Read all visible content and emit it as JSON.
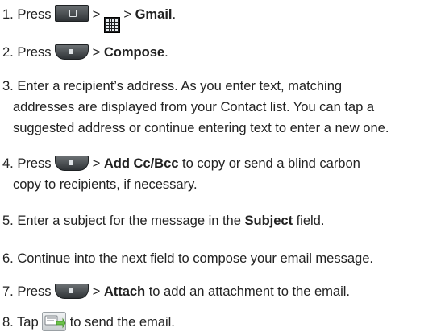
{
  "steps": [
    {
      "num": "1.",
      "t1": "Press",
      "t2": ">",
      "t3": "> ",
      "bold": "Gmail",
      "t4": "."
    },
    {
      "num": "2.",
      "t1": "Press",
      "t2": "> ",
      "bold": "Compose",
      "t3": "."
    },
    {
      "num": "3.",
      "lines": [
        "Enter a recipient’s address. As you enter text, matching",
        "addresses are displayed from your Contact list. You can tap a",
        "suggested address or continue entering text to enter a new one."
      ]
    },
    {
      "num": "4.",
      "t1": "Press",
      "t2": "> ",
      "bold": "Add Cc/Bcc",
      "t3": " to copy or send a blind carbon",
      "line2": "copy to recipients, if necessary."
    },
    {
      "num": "5.",
      "t1": "Enter a subject for the message in the ",
      "bold": "Subject",
      "t2": " field."
    },
    {
      "num": "6.",
      "t1": "Continue into the next field to compose your email message."
    },
    {
      "num": "7.",
      "t1": "Press",
      "t2": "> ",
      "bold": "Attach",
      "t3": " to add an attachment to the email."
    },
    {
      "num": "8.",
      "t1": "Tap",
      "t2": " to send the email."
    }
  ],
  "icons": {
    "home_key": "home-key-icon",
    "apps_grid": "applications-grid-icon",
    "menu_key": "menu-key-icon",
    "send": "send-email-icon"
  },
  "colors": {
    "text": "#222222",
    "key_dark": "#2f3336",
    "key_light": "#6b7073"
  }
}
